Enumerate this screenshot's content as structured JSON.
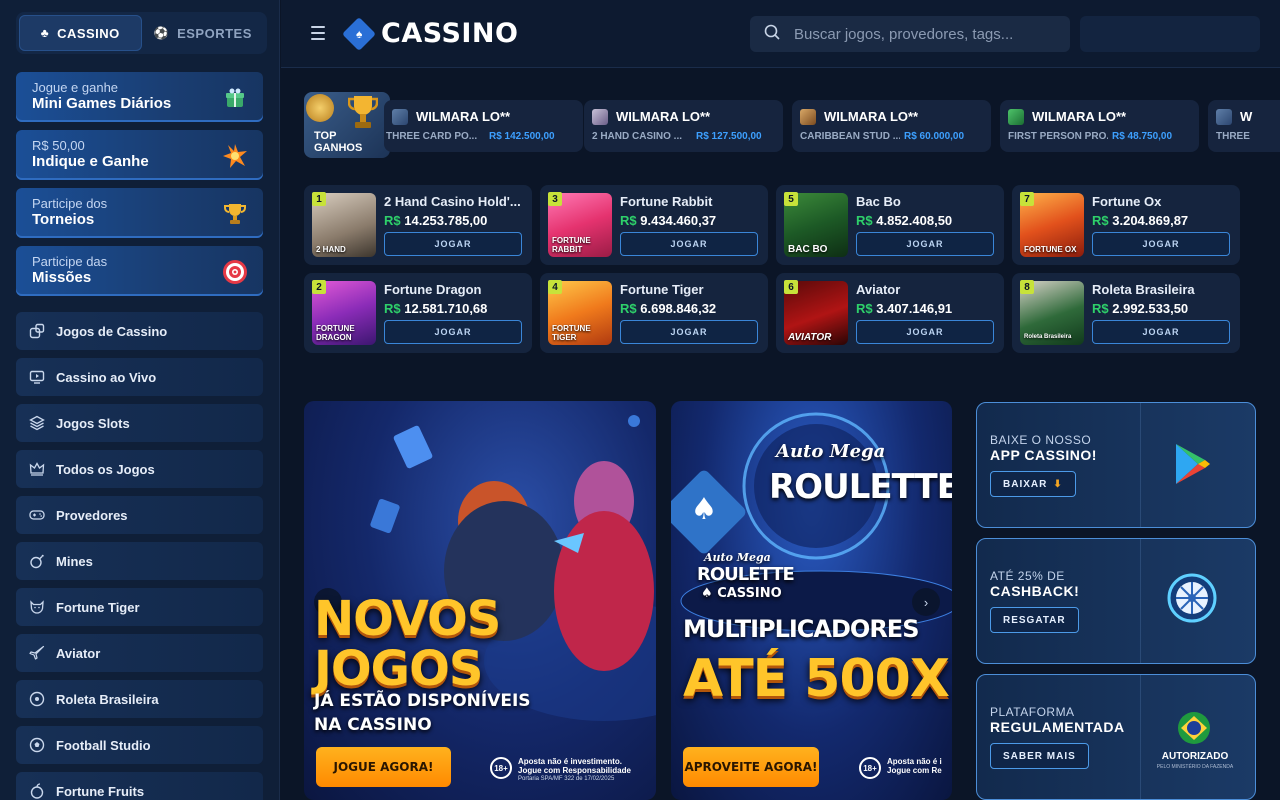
{
  "topnav": {
    "casino": "CASSINO",
    "esportes": "ESPORTES"
  },
  "promos": [
    {
      "small": "Jogue e ganhe",
      "big": "Mini Games Diários",
      "icon": "gift-icon"
    },
    {
      "small": "R$ 50,00",
      "big": "Indique e Ganhe",
      "icon": "burst-icon"
    },
    {
      "small": "Participe dos",
      "big": "Torneios",
      "icon": "trophy-icon"
    },
    {
      "small": "Participe das",
      "big": "Missões",
      "icon": "target-icon"
    }
  ],
  "nav": [
    {
      "label": "Jogos de Cassino",
      "icon": "dice-icon"
    },
    {
      "label": "Cassino ao Vivo",
      "icon": "live-tv-icon"
    },
    {
      "label": "Jogos Slots",
      "icon": "layers-icon"
    },
    {
      "label": "Todos os Jogos",
      "icon": "crown-icon"
    },
    {
      "label": "Provedores",
      "icon": "gamepad-icon"
    },
    {
      "label": "Mines",
      "icon": "bomb-icon"
    },
    {
      "label": "Fortune Tiger",
      "icon": "tiger-icon"
    },
    {
      "label": "Aviator",
      "icon": "plane-icon"
    },
    {
      "label": "Roleta Brasileira",
      "icon": "roulette-icon"
    },
    {
      "label": "Football Studio",
      "icon": "football-icon"
    },
    {
      "label": "Fortune Fruits",
      "icon": "fruit-icon"
    }
  ],
  "header": {
    "logo": "CASSINO",
    "search_placeholder": "Buscar jogos, provedores, tags..."
  },
  "top_ganhos": {
    "label_1": "TOP",
    "label_2": "GANHOS"
  },
  "winners": [
    {
      "name": "WILMARA LO**",
      "game": "THREE CARD PO...",
      "amount": "R$ 142.500,00"
    },
    {
      "name": "WILMARA LO**",
      "game": "2 HAND CASINO ...",
      "amount": "R$ 127.500,00"
    },
    {
      "name": "WILMARA LO**",
      "game": "CARIBBEAN STUD ...",
      "amount": "R$ 60.000,00"
    },
    {
      "name": "WILMARA LO**",
      "game": "FIRST PERSON PRO...",
      "amount": "R$ 48.750,00"
    },
    {
      "name": "W",
      "game": "THREE",
      "amount": ""
    }
  ],
  "games": [
    {
      "rank": "1",
      "name": "2 Hand Casino Hold'...",
      "currency": "R$",
      "value": "14.253.785,00",
      "button": "JOGAR",
      "thumb_label": "2 HAND"
    },
    {
      "rank": "3",
      "name": "Fortune Rabbit",
      "currency": "R$",
      "value": "9.434.460,37",
      "button": "JOGAR",
      "thumb_label": "FORTUNE RABBIT"
    },
    {
      "rank": "5",
      "name": "Bac Bo",
      "currency": "R$",
      "value": "4.852.408,50",
      "button": "JOGAR",
      "thumb_label": "BAC BO"
    },
    {
      "rank": "7",
      "name": "Fortune Ox",
      "currency": "R$",
      "value": "3.204.869,87",
      "button": "JOGAR",
      "thumb_label": "FORTUNE OX"
    },
    {
      "rank": "2",
      "name": "Fortune Dragon",
      "currency": "R$",
      "value": "12.581.710,68",
      "button": "JOGAR",
      "thumb_label": "FORTUNE DRAGON"
    },
    {
      "rank": "4",
      "name": "Fortune Tiger",
      "currency": "R$",
      "value": "6.698.846,32",
      "button": "JOGAR",
      "thumb_label": "FORTUNE TIGER"
    },
    {
      "rank": "6",
      "name": "Aviator",
      "currency": "R$",
      "value": "3.407.146,91",
      "button": "JOGAR",
      "thumb_label": "AVIATOR"
    },
    {
      "rank": "8",
      "name": "Roleta Brasileira",
      "currency": "R$",
      "value": "2.992.533,50",
      "button": "JOGAR",
      "thumb_label": "Roleta Brasileira"
    }
  ],
  "banner1": {
    "title_1": "NOVOS",
    "title_2": "JOGOS",
    "sub_1": "JÁ ESTÃO DISPONÍVEIS",
    "sub_2": "NA CASSINO",
    "button": "JOGUE AGORA!",
    "age": "18+",
    "disclaimer_1": "Aposta não é investimento.",
    "disclaimer_2": "Jogue com Responsabilidade",
    "disclaimer_3": "Portaria SPA/MF 322 de 17/02/2025"
  },
  "banner2": {
    "headline_1": "Auto Mega",
    "headline_2": "ROULETTE",
    "small_1": "Auto Mega",
    "small_2": "ROULETTE",
    "small_3": "CASSINO",
    "title_1": "MULTIPLICADORES",
    "title_2": "ATÉ 500X",
    "button": "APROVEITE AGORA!",
    "age": "18+",
    "disclaimer_1": "Aposta não é i",
    "disclaimer_2": "Jogue com Re"
  },
  "side_cards": [
    {
      "line1": "BAIXE O NOSSO",
      "line2": "APP CASSINO!",
      "button": "BAIXAR",
      "icon": "google-play-icon"
    },
    {
      "line1": "ATÉ 25% DE",
      "line2": "CASHBACK!",
      "button": "RESGATAR",
      "icon": "wheel-icon"
    },
    {
      "line1": "PLATAFORMA",
      "line2": "REGULAMENTADA",
      "button": "SABER MAIS",
      "icon": "brazil-flag-icon",
      "badge": "AUTORIZADO",
      "badge_sub": "PELO MINISTÉRIO DA FAZENDA"
    }
  ]
}
